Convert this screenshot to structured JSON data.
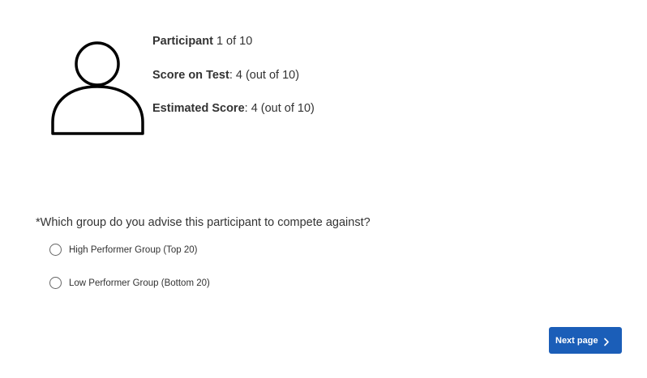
{
  "participant": {
    "avatar_icon": "person-icon",
    "line1": {
      "label": "Participant",
      "value": " 1 of 10"
    },
    "line2": {
      "label": "Score on Test",
      "value": ": 4 (out of 10)"
    },
    "line3": {
      "label": "Estimated Score",
      "value": ": 4 (out of 10)"
    }
  },
  "question": {
    "text": "*Which group do you advise this participant to compete against?",
    "options": [
      {
        "label": "High Performer Group (Top 20)",
        "selected": false
      },
      {
        "label": "Low Performer Group (Bottom 20)",
        "selected": false
      }
    ]
  },
  "navigation": {
    "next_label": "Next page",
    "next_icon": "chevron-right-icon",
    "accent_color": "#1b5eb8"
  }
}
